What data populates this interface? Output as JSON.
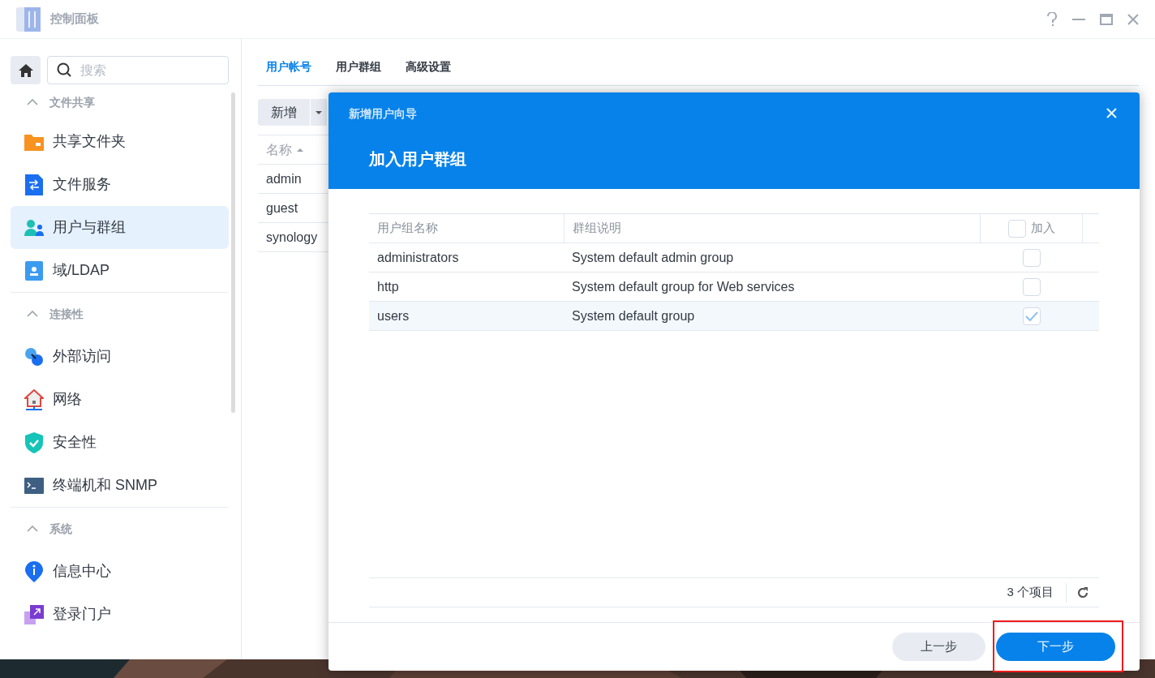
{
  "window": {
    "title": "控制面板"
  },
  "sidebar": {
    "search": {
      "placeholder": "搜索"
    },
    "sections": [
      {
        "title": "文件共享",
        "expanded": true,
        "items": [
          {
            "label": "共享文件夹",
            "selected": false
          },
          {
            "label": "文件服务",
            "selected": false
          },
          {
            "label": "用户与群组",
            "selected": true
          },
          {
            "label": "域/LDAP",
            "selected": false
          }
        ]
      },
      {
        "title": "连接性",
        "expanded": true,
        "items": [
          {
            "label": "外部访问",
            "selected": false
          },
          {
            "label": "网络",
            "selected": false
          },
          {
            "label": "安全性",
            "selected": false
          },
          {
            "label": "终端机和 SNMP",
            "selected": false
          }
        ]
      },
      {
        "title": "系统",
        "expanded": true,
        "items": [
          {
            "label": "信息中心",
            "selected": false
          },
          {
            "label": "登录门户",
            "selected": false
          }
        ]
      }
    ]
  },
  "tabs": [
    {
      "label": "用户帐号",
      "selected": true
    },
    {
      "label": "用户群组",
      "selected": false
    },
    {
      "label": "高级设置",
      "selected": false
    }
  ],
  "toolbar": {
    "add_button": "新增"
  },
  "user_table": {
    "columns": [
      "名称"
    ],
    "rows": [
      "admin",
      "guest",
      "synology"
    ]
  },
  "dialog": {
    "title": "新增用户向导",
    "subtitle": "加入用户群组",
    "columns": [
      "用户组名称",
      "群组说明",
      "加入"
    ],
    "header_checked": false,
    "rows": [
      {
        "name": "administrators",
        "description": "System default admin group",
        "checked": false,
        "selected": false
      },
      {
        "name": "http",
        "description": "System default group for Web services",
        "checked": false,
        "selected": false
      },
      {
        "name": "users",
        "description": "System default group",
        "checked": true,
        "selected": true
      }
    ],
    "item_count": "3 个项目",
    "back_button": "上一步",
    "next_button": "下一步"
  }
}
